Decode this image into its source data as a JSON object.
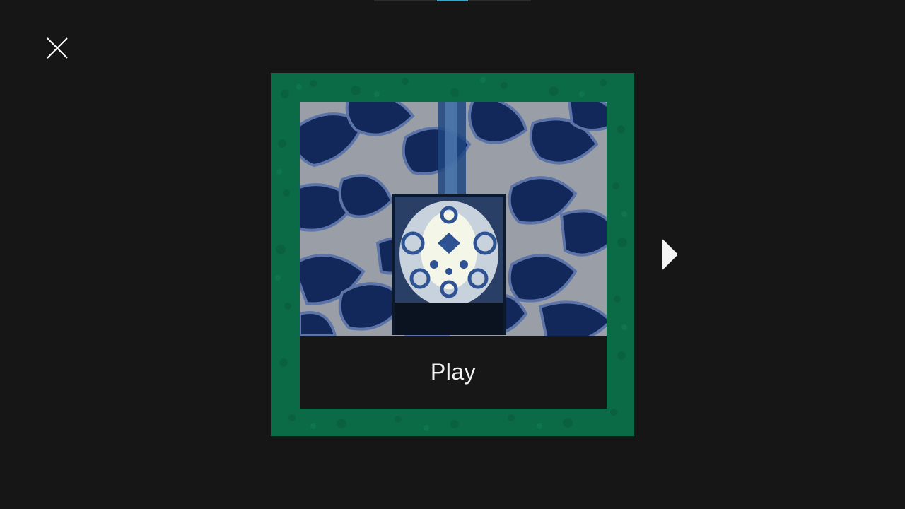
{
  "screen": {
    "background": "#161616"
  },
  "page_indicator": {
    "track_color": "#2c2c2c",
    "active_color": "#3aa7c9"
  },
  "close_button": {
    "icon": "close-icon"
  },
  "next_button": {
    "icon": "chevron-right-icon"
  },
  "level_card": {
    "frame_color": "#0c6b47",
    "thumbnail_colors": {
      "navy": "#13285a",
      "grey": "#9a9ea6",
      "glow": "#f4f6e8"
    },
    "play_label": "Play"
  }
}
